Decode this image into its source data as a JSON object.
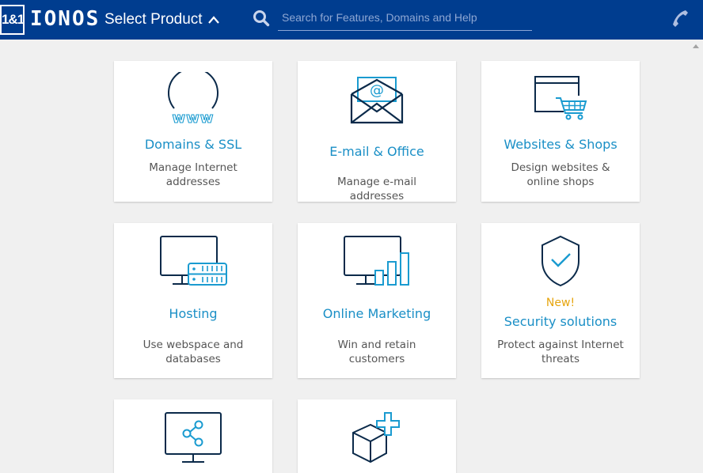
{
  "header": {
    "logo_box": "1&1",
    "logo_text": "IONOS",
    "select_product_label": "Select Product",
    "search": {
      "placeholder": "Search for Features, Domains and Help",
      "value": ""
    },
    "icons": {
      "search": "search-icon",
      "chevron": "chevron-up-icon",
      "phone": "phone-icon"
    },
    "colors": {
      "bar": "#003d8f"
    }
  },
  "cards": [
    {
      "icon": "globe-www-icon",
      "title": "Domains & SSL",
      "description": "Manage Internet addresses"
    },
    {
      "icon": "email-envelope-icon",
      "title": "E-mail & Office",
      "description": "Manage e-mail addresses"
    },
    {
      "icon": "browser-cart-icon",
      "title": "Websites & Shops",
      "description": "Design websites & online shops"
    },
    {
      "icon": "monitor-server-icon",
      "title": "Hosting",
      "description": "Use webspace and databases"
    },
    {
      "icon": "monitor-bar-chart-icon",
      "title": "Online Marketing",
      "description": "Win and retain customers"
    },
    {
      "icon": "shield-check-icon",
      "badge": "New!",
      "title": "Security solutions",
      "description": "Protect against Internet threats"
    },
    {
      "icon": "monitor-share-icon"
    },
    {
      "icon": "box-plus-icon"
    }
  ],
  "colors": {
    "title": "#1a8fc6",
    "badge": "#e6a50e",
    "icon_stroke": "#0b2a4a",
    "icon_accent": "#1a9bd0"
  }
}
